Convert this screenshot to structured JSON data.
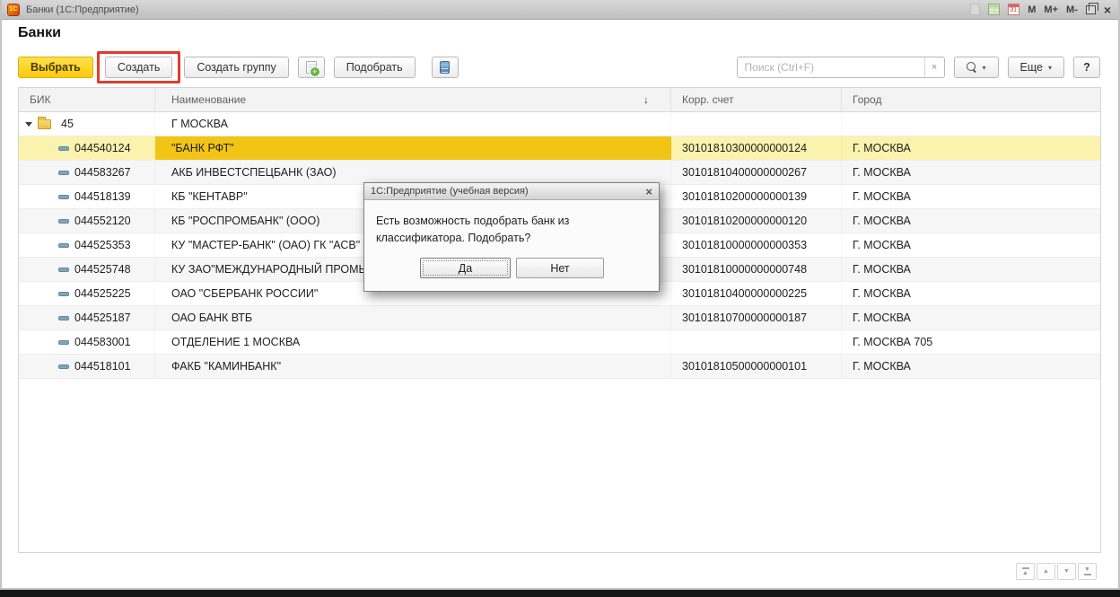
{
  "window": {
    "title": "Банки  (1С:Предприятие)",
    "logo": "1С",
    "memory": [
      "M",
      "M+",
      "M-"
    ]
  },
  "page": {
    "title": "Банки"
  },
  "toolbar": {
    "select": "Выбрать",
    "create": "Создать",
    "create_group": "Создать группу",
    "pick": "Подобрать",
    "more": "Еще",
    "help": "?",
    "search_placeholder": "Поиск (Ctrl+F)"
  },
  "icons": {
    "sort_desc": "↓",
    "caret": "▾",
    "close_x": "×",
    "tri_up": "▲",
    "tri_down": "▼"
  },
  "table": {
    "columns": [
      "БИК",
      "Наименование",
      "Корр. счет",
      "Город"
    ],
    "group": {
      "count": "45",
      "name": "Г МОСКВА"
    },
    "rows": [
      {
        "bik": "044540124",
        "name": "\"БАНК РФТ\"",
        "corr": "30101810300000000124",
        "city": "Г. МОСКВА"
      },
      {
        "bik": "044583267",
        "name": "АКБ ИНВЕСТСПЕЦБАНК (ЗАО)",
        "corr": "30101810400000000267",
        "city": "Г. МОСКВА"
      },
      {
        "bik": "044518139",
        "name": "КБ \"КЕНТАВР\"",
        "corr": "30101810200000000139",
        "city": "Г. МОСКВА"
      },
      {
        "bik": "044552120",
        "name": "КБ \"РОСПРОМБАНК\" (ООО)",
        "corr": "30101810200000000120",
        "city": "Г. МОСКВА"
      },
      {
        "bik": "044525353",
        "name": "КУ \"МАСТЕР-БАНК\" (ОАО) ГК \"АСВ\"",
        "corr": "30101810000000000353",
        "city": "Г. МОСКВА"
      },
      {
        "bik": "044525748",
        "name": "КУ ЗАО\"МЕЖДУНАРОДНЫЙ ПРОМЫШ",
        "corr": "30101810000000000748",
        "city": "Г. МОСКВА"
      },
      {
        "bik": "044525225",
        "name": "ОАО \"СБЕРБАНК РОССИИ\"",
        "corr": "30101810400000000225",
        "city": "Г. МОСКВА"
      },
      {
        "bik": "044525187",
        "name": "ОАО БАНК ВТБ",
        "corr": "30101810700000000187",
        "city": "Г. МОСКВА"
      },
      {
        "bik": "044583001",
        "name": "ОТДЕЛЕНИЕ 1 МОСКВА",
        "corr": "",
        "city": "Г. МОСКВА 705"
      },
      {
        "bik": "044518101",
        "name": "ФАКБ \"КАМИНБАНК\"",
        "corr": "30101810500000000101",
        "city": "Г. МОСКВА"
      }
    ]
  },
  "dialog": {
    "title": "1С:Предприятие (учебная версия)",
    "message": "Есть возможность подобрать банк из классификатора. Подобрать?",
    "yes": "Да",
    "no": "Нет"
  },
  "colors": {
    "selection_cell_gold": "#f2c416",
    "selection_row_yellow": "#fbf2ae",
    "select_button_yellow": "#fcc90b",
    "annotation_red": "#e23b2e"
  }
}
